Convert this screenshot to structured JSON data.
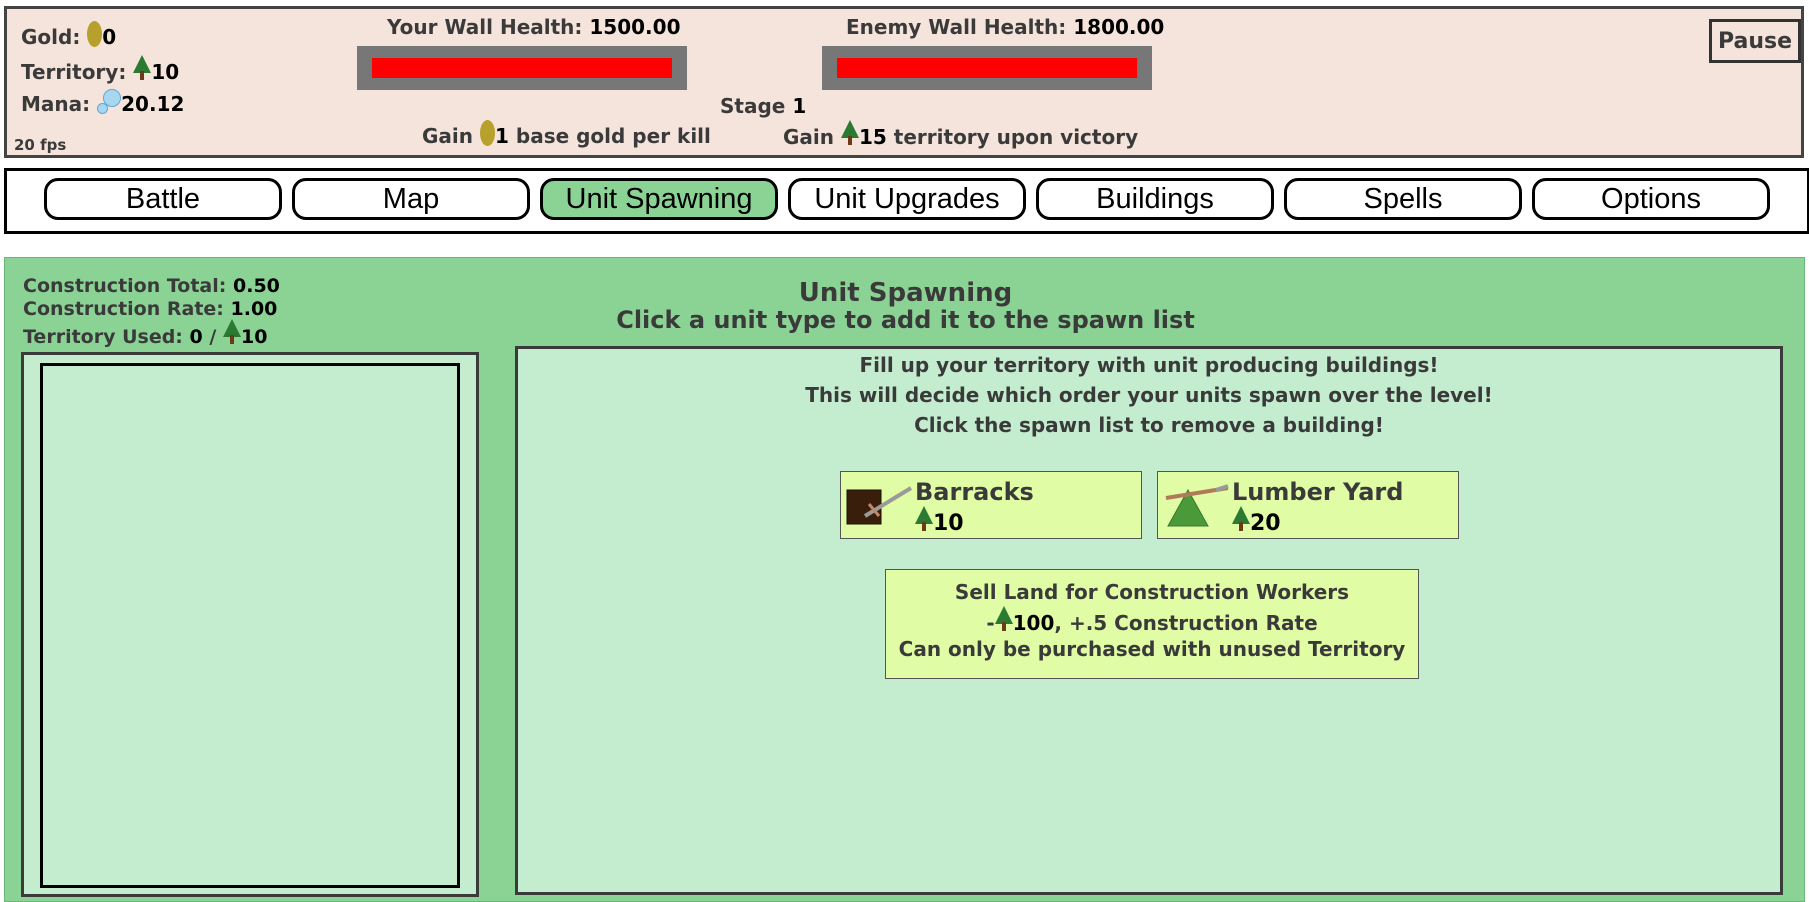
{
  "resources": {
    "gold_label": "Gold:",
    "gold_value": "0",
    "territory_label": "Territory:",
    "territory_value": "10",
    "mana_label": "Mana:",
    "mana_value": "20.12",
    "fps": "20 fps"
  },
  "walls": {
    "your_label": "Your Wall Health:",
    "your_value": "1500.00",
    "your_fraction": 1.0,
    "enemy_label": "Enemy Wall Health:",
    "enemy_value": "1800.00",
    "enemy_fraction": 1.0
  },
  "stage": {
    "label": "Stage",
    "value": "1"
  },
  "rewards": {
    "gold_prefix": "Gain",
    "gold_value": "1",
    "gold_suffix": "base gold per kill",
    "territory_prefix": "Gain",
    "territory_value": "15",
    "territory_suffix": "territory upon victory"
  },
  "pause_label": "Pause",
  "tabs": [
    {
      "label": "Battle",
      "active": false
    },
    {
      "label": "Map",
      "active": false
    },
    {
      "label": "Unit Spawning",
      "active": true
    },
    {
      "label": "Unit Upgrades",
      "active": false
    },
    {
      "label": "Buildings",
      "active": false
    },
    {
      "label": "Spells",
      "active": false
    },
    {
      "label": "Options",
      "active": false
    }
  ],
  "construction": {
    "total_label": "Construction Total:",
    "total_value": "0.50",
    "rate_label": "Construction Rate:",
    "rate_value": "1.00",
    "territory_used_label": "Territory Used:",
    "territory_used_value": "0",
    "territory_used_sep": "/",
    "territory_used_max": "10"
  },
  "main": {
    "title": "Unit Spawning",
    "subtitle": "Click a unit type to add it to the spawn list",
    "info_lines": [
      "Fill up your territory with unit producing buildings!",
      "This will decide which order your units spawn over the level!",
      "Click the spawn list to remove a building!"
    ],
    "buildings": [
      {
        "name": "Barracks",
        "cost": "10",
        "icon": "barracks-icon"
      },
      {
        "name": "Lumber Yard",
        "cost": "20",
        "icon": "lumber-yard-icon"
      }
    ],
    "sell": {
      "title": "Sell Land for Construction Workers",
      "cost_prefix": "-",
      "cost_value": "100",
      "cost_suffix": ", +.5 Construction Rate",
      "note": "Can only be purchased with unused Territory"
    }
  },
  "colors": {
    "topbar_bg": "#f5e4db",
    "health_fill": "#ff0000",
    "main_bg": "#8bd395",
    "panel_bg": "#c4ecce",
    "card_bg": "#e0fca5",
    "active_tab": "#8bd395"
  }
}
